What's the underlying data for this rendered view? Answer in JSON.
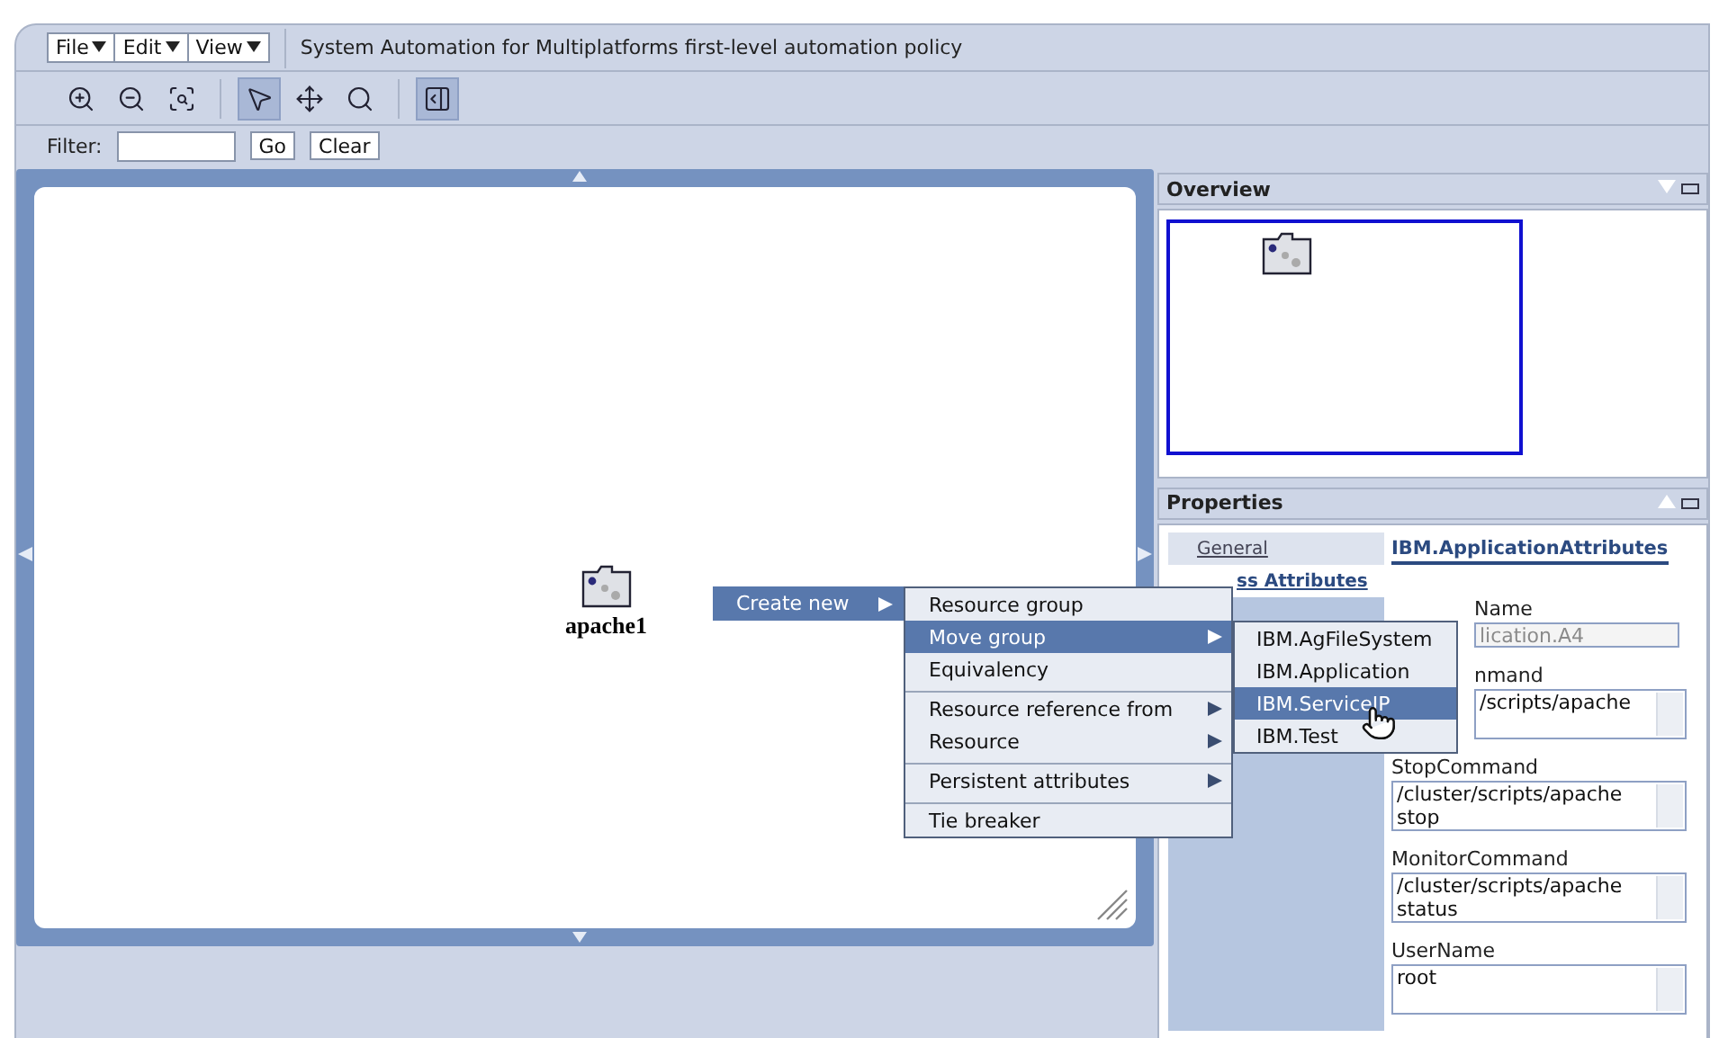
{
  "menubar": [
    {
      "label": "File"
    },
    {
      "label": "Edit"
    },
    {
      "label": "View"
    }
  ],
  "title": "System Automation for Multiplatforms first-level automation policy",
  "toolbar": [
    {
      "kind": "zoom-in",
      "selected": false
    },
    {
      "kind": "zoom-out",
      "selected": false
    },
    {
      "kind": "zoom-fit",
      "selected": false
    },
    {
      "kind": "select",
      "selected": true
    },
    {
      "kind": "pan",
      "selected": false
    },
    {
      "kind": "zoom-area",
      "selected": false
    },
    {
      "kind": "toggle-pane",
      "selected": true
    }
  ],
  "filter": {
    "label": "Filter:",
    "go": "Go",
    "clear": "Clear"
  },
  "canvas": {
    "nodes": [
      {
        "label": "apache1"
      }
    ]
  },
  "context_menu": {
    "label": "Create new",
    "items": [
      {
        "label": "Resource group",
        "selected": false,
        "submenu": false,
        "separator_before": false
      },
      {
        "label": "Move group",
        "selected": true,
        "submenu": true,
        "separator_before": false
      },
      {
        "label": "Equivalency",
        "selected": false,
        "submenu": false,
        "separator_before": false
      },
      {
        "label": "Resource reference from",
        "selected": false,
        "submenu": true,
        "separator_before": true
      },
      {
        "label": "Resource",
        "selected": false,
        "submenu": true,
        "separator_before": false
      },
      {
        "label": "Persistent attributes",
        "selected": false,
        "submenu": true,
        "separator_before": true
      },
      {
        "label": "Tie breaker",
        "selected": false,
        "submenu": false,
        "separator_before": true
      }
    ],
    "submenu_items": [
      {
        "label": "IBM.AgFileSystem",
        "selected": false
      },
      {
        "label": "IBM.Application",
        "selected": false
      },
      {
        "label": "IBM.ServiceIP",
        "selected": true
      },
      {
        "label": "IBM.Test",
        "selected": false
      }
    ]
  },
  "overview": {
    "title": "Overview"
  },
  "properties": {
    "title": "Properties",
    "nav": [
      {
        "label": "General",
        "selected": false
      },
      {
        "label": "ss Attributes",
        "selected": true
      }
    ],
    "heading": "IBM.ApplicationAttributes",
    "fields": [
      {
        "label": "Name",
        "value": "lication.A4",
        "kind": "text",
        "disabled": true,
        "obscured": true
      },
      {
        "label": "nmand",
        "value": "/scripts/apache",
        "kind": "textarea",
        "disabled": false,
        "obscured": true
      },
      {
        "label": "StopCommand",
        "value": "/cluster/scripts/apache stop",
        "kind": "textarea",
        "disabled": false,
        "obscured": false
      },
      {
        "label": "MonitorCommand",
        "value": "/cluster/scripts/apache status",
        "kind": "textarea",
        "disabled": false,
        "obscured": false
      },
      {
        "label": "UserName",
        "value": "root",
        "kind": "textarea",
        "disabled": false,
        "obscured": false
      }
    ]
  }
}
